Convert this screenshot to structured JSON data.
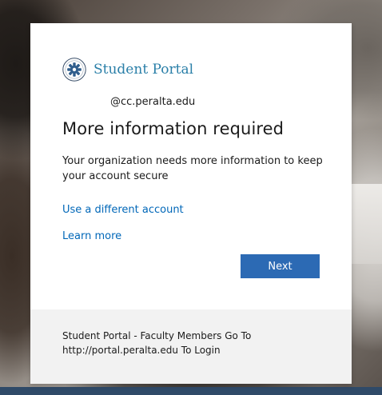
{
  "branding": {
    "portal_name": "Student Portal",
    "seal_icon": "college-seal-icon",
    "accent_color": "#2a7fa8"
  },
  "account": {
    "email": "@cc.peralta.edu"
  },
  "main": {
    "title": "More information required",
    "description": "Your organization needs more information to keep your account secure",
    "use_different_account_label": "Use a different account",
    "learn_more_label": "Learn more",
    "next_label": "Next",
    "button_color": "#2c6ab4",
    "link_color": "#0067b8"
  },
  "footer": {
    "text": "Student Portal - Faculty Members Go To http://portal.peralta.edu To Login"
  }
}
